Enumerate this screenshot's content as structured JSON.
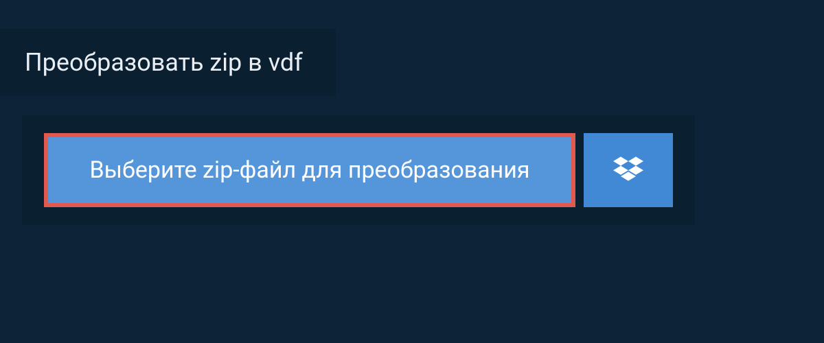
{
  "header": {
    "title": "Преобразовать zip в vdf"
  },
  "upload": {
    "select_file_label": "Выберите zip-файл для преобразования",
    "dropbox_icon_name": "dropbox-icon"
  },
  "colors": {
    "page_bg": "#0d2438",
    "panel_bg": "#0a1f30",
    "primary_button_bg": "#5596db",
    "primary_button_border": "#e05a4f",
    "secondary_button_bg": "#4189d5",
    "text_light": "#e8eef4",
    "text_white": "#ffffff"
  }
}
